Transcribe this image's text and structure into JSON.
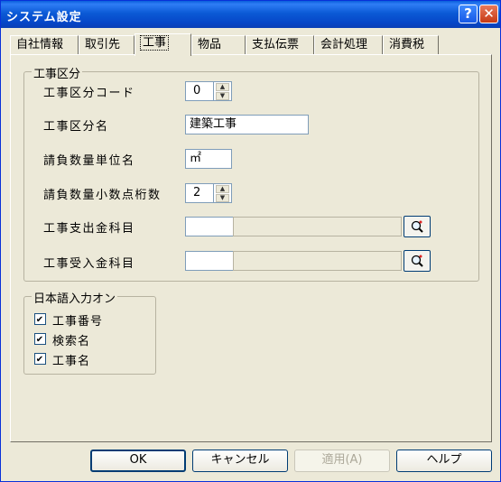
{
  "window": {
    "title": "システム設定",
    "help_glyph": "?",
    "close_glyph": "✕"
  },
  "tabs": [
    {
      "label": "自社情報"
    },
    {
      "label": "取引先"
    },
    {
      "label": "工事",
      "active": true
    },
    {
      "label": "物品"
    },
    {
      "label": "支払伝票"
    },
    {
      "label": "会計処理"
    },
    {
      "label": "消費税"
    }
  ],
  "koji_kubun": {
    "group_title": "工事区分",
    "code_label": "工事区分コード",
    "code_value": "0",
    "name_label": "工事区分名",
    "name_value": "建築工事",
    "unit_label": "請負数量単位名",
    "unit_value": "㎡",
    "decimal_label": "請負数量小数点桁数",
    "decimal_value": "2",
    "expense_label": "工事支出金科目",
    "expense_code": "",
    "expense_name": "",
    "income_label": "工事受入金科目",
    "income_code": "",
    "income_name": ""
  },
  "ime": {
    "group_title": "日本語入力オン",
    "items": [
      {
        "label": "工事番号",
        "checked": true
      },
      {
        "label": "検索名",
        "checked": true
      },
      {
        "label": "工事名",
        "checked": true
      }
    ]
  },
  "buttons": {
    "ok": "OK",
    "cancel": "キャンセル",
    "apply": "適用(A)",
    "help": "ヘルプ"
  },
  "icons": {
    "lookup": "magnifier-icon",
    "spin_up": "spin-up-icon",
    "spin_down": "spin-down-icon"
  },
  "colors": {
    "titlebar": "#0a5fdc",
    "face": "#ece9d8"
  }
}
